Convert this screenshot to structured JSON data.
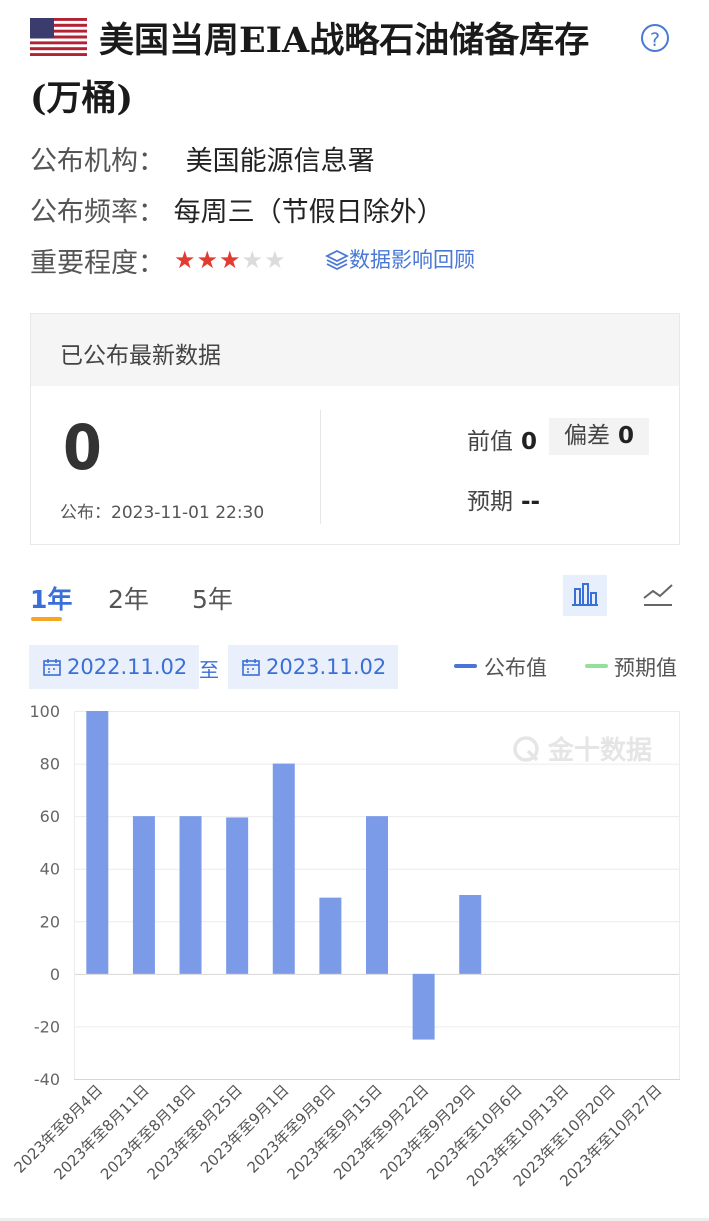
{
  "header": {
    "title": "美国当周EIA战略石油储备库存",
    "unit": "(万桶)",
    "help_icon": "question-circle-icon",
    "flag_icon": "us-flag-icon"
  },
  "meta": {
    "publisher_label": "公布机构：",
    "publisher_value": "美国能源信息署",
    "frequency_label": "公布频率：",
    "frequency_value": "每周三（节假日除外）",
    "importance_label": "重要程度：",
    "importance_stars": 3,
    "importance_max": 5,
    "review_link": "数据影响回顾"
  },
  "latest": {
    "header": "已公布最新数据",
    "value": "0",
    "published": "公布：2023-11-01 22:30",
    "previous_label": "前值",
    "previous_value": "0",
    "deviation_label": "偏差",
    "deviation_value": "0",
    "forecast_label": "预期",
    "forecast_value": "--"
  },
  "controls": {
    "tabs": [
      "1年",
      "2年",
      "5年"
    ],
    "active_tab": 0,
    "start_date": "2022.11.02",
    "to": "至",
    "end_date": "2023.11.02",
    "legend_actual": "公布值",
    "legend_forecast": "预期值"
  },
  "colors": {
    "bar": "#7b9be8",
    "accent": "#3a6fd8",
    "legend_actual": "#4a74d6",
    "legend_forecast": "#94df9a",
    "star_on": "#e23b30"
  },
  "chart_data": {
    "type": "bar",
    "categories": [
      "2023年至8月4日",
      "2023年至8月11日",
      "2023年至8月18日",
      "2023年至8月25日",
      "2023年至9月1日",
      "2023年至9月8日",
      "2023年至9月15日",
      "2023年至9月22日",
      "2023年至9月29日",
      "2023年至10月6日",
      "2023年至10月13日",
      "2023年至10月20日",
      "2023年至10月27日"
    ],
    "series": [
      {
        "name": "公布值",
        "values": [
          100,
          60,
          60,
          59.5,
          80,
          29,
          60,
          -25,
          30,
          0,
          0,
          0,
          0
        ]
      }
    ],
    "yticks": [
      100,
      80,
      60,
      40,
      20,
      0,
      -20,
      -40
    ],
    "ylim": [
      -40,
      100
    ],
    "watermark": "金十数据",
    "grid": true
  }
}
